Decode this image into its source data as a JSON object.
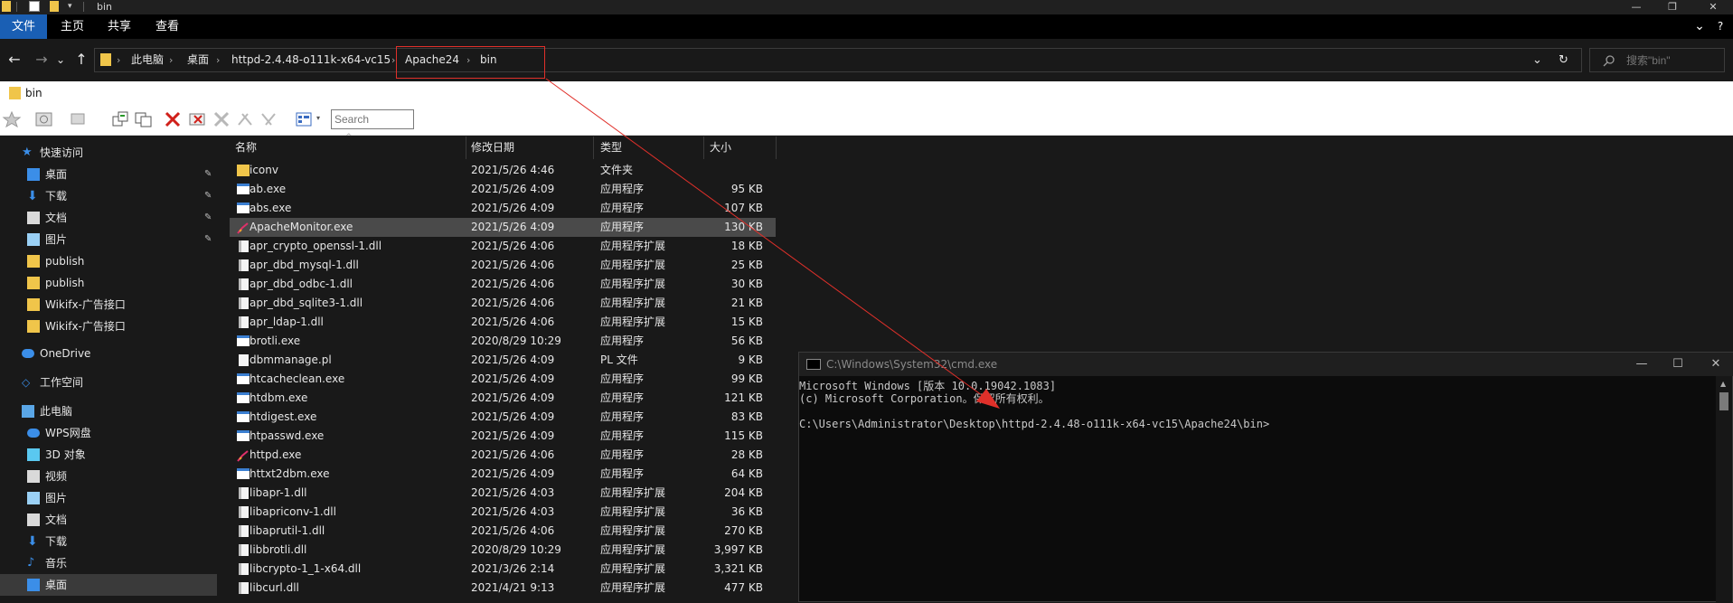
{
  "window": {
    "title": "bin",
    "controls": {
      "minimize": "—",
      "maximize": "❐",
      "close": "✕"
    }
  },
  "ribbon": {
    "tabs": [
      {
        "label": "文件"
      },
      {
        "label": "主页"
      },
      {
        "label": "共享"
      },
      {
        "label": "查看"
      }
    ],
    "expand": "⌄",
    "help": "?"
  },
  "nav": {
    "back": "←",
    "forward": "→",
    "recent": "⌄",
    "up": "↑"
  },
  "address": {
    "crumbs": [
      "此电脑",
      "桌面",
      "httpd-2.4.48-o111k-x64-vc15",
      "Apache24",
      "bin"
    ],
    "separator": "›",
    "dropdown": "⌄",
    "refresh": "↻"
  },
  "search": {
    "placeholder": "搜索\"bin\"",
    "icon": "search-icon"
  },
  "tabstrip": {
    "tab_label": "bin"
  },
  "toolbar": {
    "search_placeholder": "Search"
  },
  "sidebar": {
    "items": [
      {
        "label": "快速访问",
        "icon": "star-icon",
        "pinned": false,
        "section": true
      },
      {
        "label": "桌面",
        "icon": "desktop-icon",
        "pinned": true
      },
      {
        "label": "下载",
        "icon": "download-icon",
        "pinned": true
      },
      {
        "label": "文档",
        "icon": "document-icon",
        "pinned": true
      },
      {
        "label": "图片",
        "icon": "picture-icon",
        "pinned": true
      },
      {
        "label": "publish",
        "icon": "folder-icon",
        "pinned": false
      },
      {
        "label": "publish",
        "icon": "folder-icon",
        "pinned": false
      },
      {
        "label": "Wikifx-广告接口",
        "icon": "folder-icon",
        "pinned": false
      },
      {
        "label": "Wikifx-广告接口",
        "icon": "folder-icon",
        "pinned": false
      },
      {
        "label": "OneDrive",
        "icon": "cloud-icon",
        "pinned": false,
        "section": true
      },
      {
        "label": "工作空间",
        "icon": "workspace-icon",
        "pinned": false,
        "section": true
      },
      {
        "label": "此电脑",
        "icon": "computer-icon",
        "pinned": false,
        "section": true
      },
      {
        "label": "WPS网盘",
        "icon": "cloud-icon",
        "pinned": false
      },
      {
        "label": "3D 对象",
        "icon": "cube-icon",
        "pinned": false
      },
      {
        "label": "视频",
        "icon": "video-icon",
        "pinned": false
      },
      {
        "label": "图片",
        "icon": "picture-icon",
        "pinned": false
      },
      {
        "label": "文档",
        "icon": "document-icon",
        "pinned": false
      },
      {
        "label": "下载",
        "icon": "download-icon",
        "pinned": false
      },
      {
        "label": "音乐",
        "icon": "music-icon",
        "pinned": false
      },
      {
        "label": "桌面",
        "icon": "desktop-icon",
        "pinned": false,
        "selected": true
      }
    ],
    "pin_glyph": "📌"
  },
  "filelist": {
    "columns": [
      "名称",
      "修改日期",
      "类型",
      "大小"
    ],
    "sort_glyph": "^",
    "rows": [
      {
        "name": "iconv",
        "date": "2021/5/26 4:46",
        "type": "文件夹",
        "size": "",
        "icon": "folder-icon"
      },
      {
        "name": "ab.exe",
        "date": "2021/5/26 4:09",
        "type": "应用程序",
        "size": "95 KB",
        "icon": "exe-icon"
      },
      {
        "name": "abs.exe",
        "date": "2021/5/26 4:09",
        "type": "应用程序",
        "size": "107 KB",
        "icon": "exe-icon"
      },
      {
        "name": "ApacheMonitor.exe",
        "date": "2021/5/26 4:09",
        "type": "应用程序",
        "size": "130 KB",
        "icon": "apache-feather-icon",
        "highlighted": true
      },
      {
        "name": "apr_crypto_openssl-1.dll",
        "date": "2021/5/26 4:06",
        "type": "应用程序扩展",
        "size": "18 KB",
        "icon": "dll-icon"
      },
      {
        "name": "apr_dbd_mysql-1.dll",
        "date": "2021/5/26 4:06",
        "type": "应用程序扩展",
        "size": "25 KB",
        "icon": "dll-icon"
      },
      {
        "name": "apr_dbd_odbc-1.dll",
        "date": "2021/5/26 4:06",
        "type": "应用程序扩展",
        "size": "30 KB",
        "icon": "dll-icon"
      },
      {
        "name": "apr_dbd_sqlite3-1.dll",
        "date": "2021/5/26 4:06",
        "type": "应用程序扩展",
        "size": "21 KB",
        "icon": "dll-icon"
      },
      {
        "name": "apr_ldap-1.dll",
        "date": "2021/5/26 4:06",
        "type": "应用程序扩展",
        "size": "15 KB",
        "icon": "dll-icon"
      },
      {
        "name": "brotli.exe",
        "date": "2020/8/29 10:29",
        "type": "应用程序",
        "size": "56 KB",
        "icon": "exe-icon"
      },
      {
        "name": "dbmmanage.pl",
        "date": "2021/5/26 4:09",
        "type": "PL 文件",
        "size": "9 KB",
        "icon": "file-icon"
      },
      {
        "name": "htcacheclean.exe",
        "date": "2021/5/26 4:09",
        "type": "应用程序",
        "size": "99 KB",
        "icon": "exe-icon"
      },
      {
        "name": "htdbm.exe",
        "date": "2021/5/26 4:09",
        "type": "应用程序",
        "size": "121 KB",
        "icon": "exe-icon"
      },
      {
        "name": "htdigest.exe",
        "date": "2021/5/26 4:09",
        "type": "应用程序",
        "size": "83 KB",
        "icon": "exe-icon"
      },
      {
        "name": "htpasswd.exe",
        "date": "2021/5/26 4:09",
        "type": "应用程序",
        "size": "115 KB",
        "icon": "exe-icon"
      },
      {
        "name": "httpd.exe",
        "date": "2021/5/26 4:06",
        "type": "应用程序",
        "size": "28 KB",
        "icon": "apache-feather-icon"
      },
      {
        "name": "httxt2dbm.exe",
        "date": "2021/5/26 4:09",
        "type": "应用程序",
        "size": "64 KB",
        "icon": "exe-icon"
      },
      {
        "name": "libapr-1.dll",
        "date": "2021/5/26 4:03",
        "type": "应用程序扩展",
        "size": "204 KB",
        "icon": "dll-icon"
      },
      {
        "name": "libapriconv-1.dll",
        "date": "2021/5/26 4:03",
        "type": "应用程序扩展",
        "size": "36 KB",
        "icon": "dll-icon"
      },
      {
        "name": "libaprutil-1.dll",
        "date": "2021/5/26 4:06",
        "type": "应用程序扩展",
        "size": "270 KB",
        "icon": "dll-icon"
      },
      {
        "name": "libbrotli.dll",
        "date": "2020/8/29 10:29",
        "type": "应用程序扩展",
        "size": "3,997 KB",
        "icon": "dll-icon"
      },
      {
        "name": "libcrypto-1_1-x64.dll",
        "date": "2021/3/26 2:14",
        "type": "应用程序扩展",
        "size": "3,321 KB",
        "icon": "dll-icon"
      },
      {
        "name": "libcurl.dll",
        "date": "2021/4/21 9:13",
        "type": "应用程序扩展",
        "size": "477 KB",
        "icon": "dll-icon"
      }
    ]
  },
  "cmd": {
    "title": "C:\\Windows\\System32\\cmd.exe",
    "lines": [
      "Microsoft Windows [版本 10.0.19042.1083]",
      "(c) Microsoft Corporation。保留所有权利。",
      "",
      "C:\\Users\\Administrator\\Desktop\\httpd-2.4.48-o111k-x64-vc15\\Apache24\\bin>"
    ],
    "controls": {
      "minimize": "—",
      "maximize": "☐",
      "close": "✕"
    }
  },
  "colors": {
    "accent": "#1a5fb4",
    "annotation": "#e0302a",
    "folder": "#f0c54a",
    "background": "#191919"
  }
}
